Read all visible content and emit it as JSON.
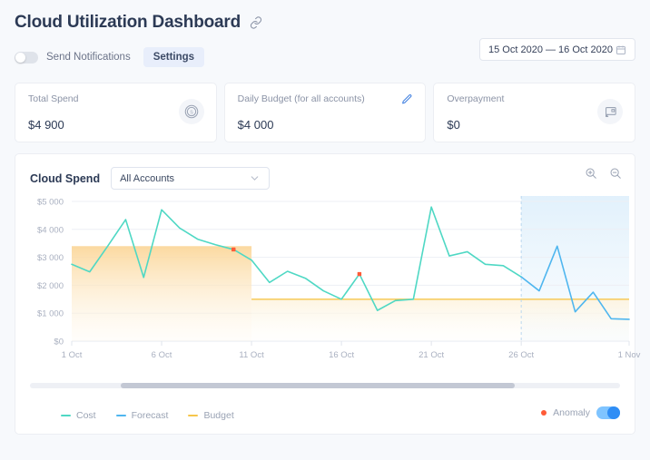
{
  "header": {
    "title": "Cloud Utilization Dashboard",
    "link_icon": "link-icon",
    "notifications_label": "Send Notifications",
    "notifications_on": false,
    "settings_label": "Settings",
    "date_range": "15 Oct 2020 — 16 Oct 2020",
    "calendar_icon": "calendar-icon"
  },
  "cards": [
    {
      "label": "Total Spend",
      "value": "$4 900",
      "icon": "coin-icon",
      "editable": false
    },
    {
      "label": "Daily Budget (for all accounts)",
      "value": "$4 000",
      "icon": "pencil-icon",
      "editable": true
    },
    {
      "label": "Overpayment",
      "value": "$0",
      "icon": "billing-icon",
      "editable": false
    }
  ],
  "panel": {
    "title": "Cloud Spend",
    "account_filter": "All Accounts",
    "account_options": [
      "All Accounts"
    ],
    "zoom_in_icon": "zoom-in-icon",
    "zoom_out_icon": "zoom-out-icon",
    "forecast_label": "Forecast",
    "legend": [
      {
        "label": "Cost",
        "color": "#4fd8c4"
      },
      {
        "label": "Forecast",
        "color": "#4fb6ef"
      },
      {
        "label": "Budget",
        "color": "#f6c64b"
      }
    ],
    "anomaly": {
      "label": "Anomaly",
      "color": "#ff5b37",
      "enabled": true
    }
  },
  "chart_data": {
    "type": "line",
    "title": "Cloud Spend",
    "xlabel": "",
    "ylabel": "",
    "ylim": [
      0,
      5000
    ],
    "yticks": [
      0,
      1000,
      2000,
      3000,
      4000,
      5000
    ],
    "ytick_labels": [
      "$0",
      "$1 000",
      "$2 000",
      "$3 000",
      "$4 000",
      "$5 000"
    ],
    "xticks": [
      "1 Oct",
      "6 Oct",
      "11 Oct",
      "16 Oct",
      "21 Oct",
      "26 Oct",
      "1 Nov"
    ],
    "xlim_days": [
      1,
      32
    ],
    "grid": true,
    "legend_position": "bottom-left",
    "forecast_start": "26 Oct",
    "budget_line_value": 1500,
    "budget_line_start": "11 Oct",
    "budget_band": {
      "start": "1 Oct",
      "end": "11 Oct",
      "top": 3400,
      "bottom": 0
    },
    "series": [
      {
        "name": "Cost",
        "color": "#4fd8c4",
        "x": [
          "1 Oct",
          "2 Oct",
          "3 Oct",
          "4 Oct",
          "5 Oct",
          "6 Oct",
          "7 Oct",
          "8 Oct",
          "9 Oct",
          "10 Oct",
          "11 Oct",
          "12 Oct",
          "13 Oct",
          "14 Oct",
          "15 Oct",
          "16 Oct",
          "17 Oct",
          "18 Oct",
          "19 Oct",
          "20 Oct",
          "21 Oct",
          "22 Oct",
          "23 Oct",
          "24 Oct",
          "25 Oct",
          "26 Oct"
        ],
        "values": [
          2750,
          2480,
          3400,
          4350,
          2280,
          4700,
          4050,
          3650,
          3450,
          3280,
          2900,
          2100,
          2500,
          2250,
          1800,
          1500,
          2400,
          1100,
          1450,
          1500,
          4800,
          3050,
          3200,
          2750,
          2700,
          2300
        ]
      },
      {
        "name": "Forecast",
        "color": "#4fb6ef",
        "x": [
          "26 Oct",
          "27 Oct",
          "28 Oct",
          "29 Oct",
          "30 Oct",
          "31 Oct",
          "1 Nov"
        ],
        "values": [
          2300,
          1800,
          3400,
          1050,
          1750,
          800,
          780
        ]
      },
      {
        "name": "Budget",
        "color": "#f6c64b",
        "x": [
          "11 Oct",
          "1 Nov"
        ],
        "values": [
          1500,
          1500
        ]
      }
    ],
    "anomalies": [
      {
        "x": "10 Oct",
        "value": 3280
      },
      {
        "x": "17 Oct",
        "value": 2400
      }
    ]
  }
}
